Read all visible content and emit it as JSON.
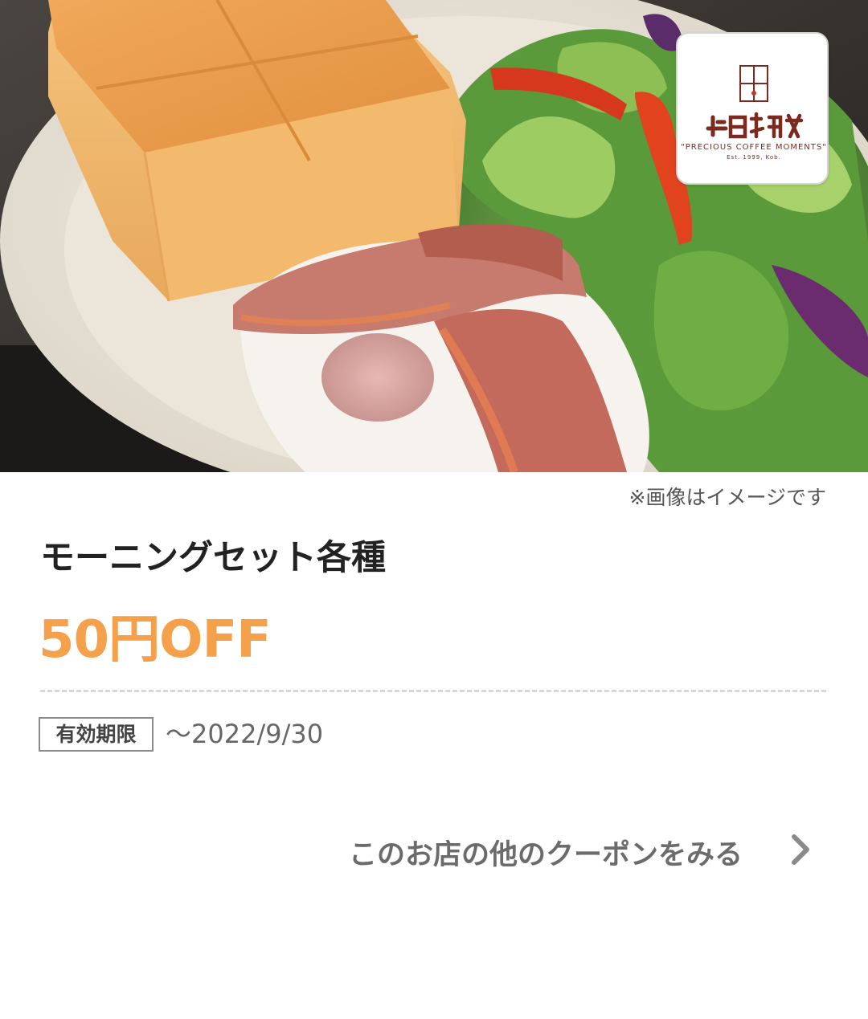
{
  "hero": {
    "image_alt": "toast-bacon-egg-salad-plate"
  },
  "shop": {
    "logo_text": "上島珈琲店",
    "logo_tagline": "\"PRECIOUS COFFEE MOMENTS\"",
    "logo_est": "Est. 1999, Kob."
  },
  "coupon": {
    "image_note": "※画像はイメージです",
    "title": "モーニングセット各種",
    "discount": "50円OFF",
    "expiry_label": "有効期限",
    "expiry_date": "〜2022/9/30"
  },
  "footer": {
    "more_coupons_label": "このお店の他のクーポンをみる",
    "more_icon": "chevron-right-icon"
  },
  "colors": {
    "discount": "#f5a04a",
    "logo": "#7a2a1e",
    "title": "#222222"
  }
}
